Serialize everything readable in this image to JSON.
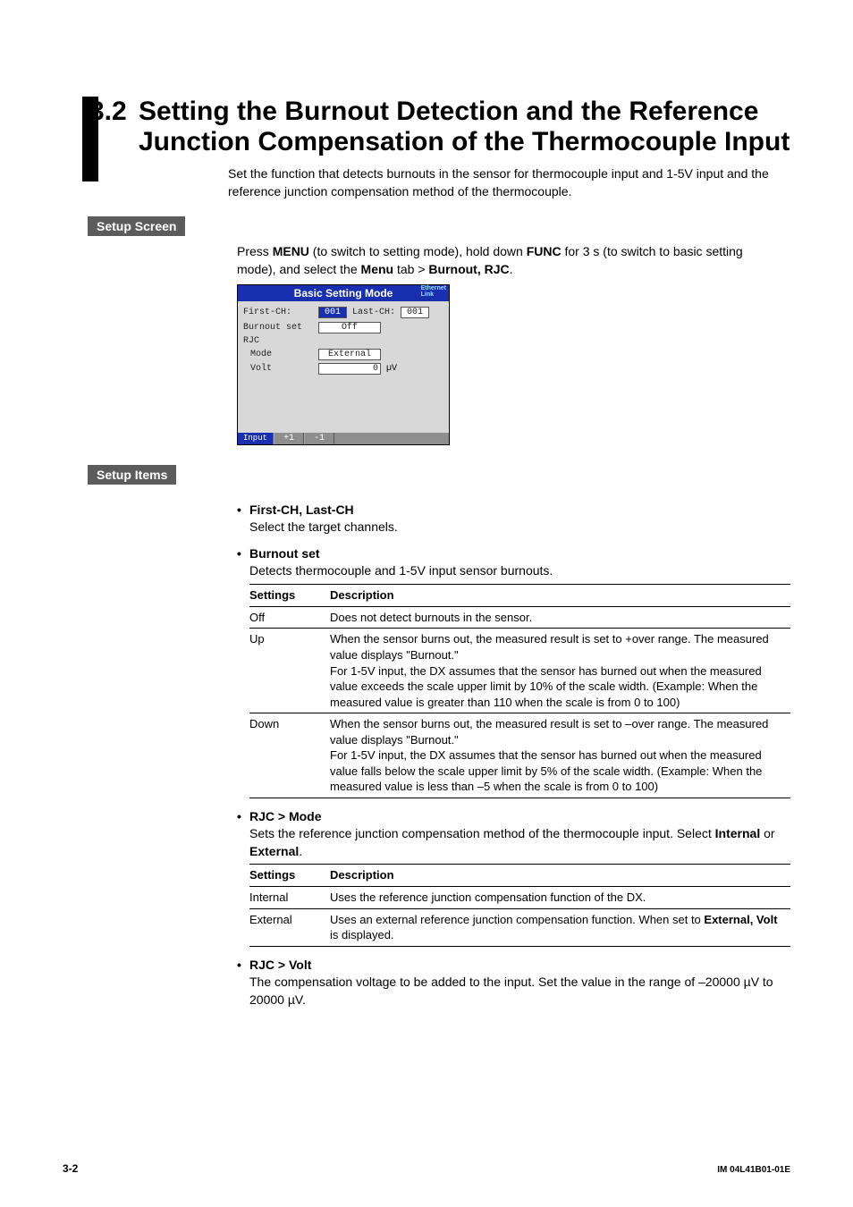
{
  "section_number": "3.2",
  "section_title": "Setting the Burnout Detection and the Reference Junction Compensation of the Thermocouple Input",
  "intro": "Set the function that detects burnouts in the sensor for thermocouple input and 1-5V input and the reference junction compensation method of the thermocouple.",
  "setup_screen": {
    "heading": "Setup Screen",
    "instruction_pre": "Press ",
    "menu_bold1": "MENU",
    "instruction_mid1": " (to switch to setting mode), hold down ",
    "func_bold": "FUNC",
    "instruction_mid2": " for 3 s (to switch to basic setting mode), and select the ",
    "menu_bold2": "Menu",
    "instruction_mid3": " tab > ",
    "path_bold": "Burnout, RJC",
    "instruction_end": ".",
    "ss": {
      "title": "Basic Setting Mode",
      "eth1": "Ethernet",
      "eth2": "Link",
      "first_ch_label": "First-CH:",
      "first_ch_val": "001",
      "last_ch_label": "Last-CH:",
      "last_ch_val": "001",
      "burnout_label": "Burnout set",
      "burnout_val": "Off",
      "rjc_label": "RJC",
      "mode_label": "Mode",
      "mode_val": "External",
      "volt_label": "Volt",
      "volt_val": "0",
      "volt_unit": "µV",
      "tab_input": "Input",
      "btn_plus": "+1",
      "btn_minus": "-1"
    }
  },
  "setup_items": {
    "heading": "Setup Items",
    "first_last": {
      "title": "First-CH, Last-CH",
      "desc": "Select the target channels."
    },
    "burnout": {
      "title": "Burnout set",
      "desc": "Detects thermocouple and 1-5V input sensor burnouts.",
      "col1": "Settings",
      "col2": "Description",
      "rows": [
        {
          "s": "Off",
          "d": "Does not detect burnouts in the sensor."
        },
        {
          "s": "Up",
          "d": "When the sensor burns out, the measured result is set to +over range. The measured value displays \"Burnout.\"\nFor 1-5V input, the DX assumes that the sensor has burned out when the measured value exceeds the scale upper limit by 10% of the scale width. (Example: When the measured value is greater than 110 when the scale is from 0 to 100)"
        },
        {
          "s": "Down",
          "d": "When the sensor burns out, the measured result is set to –over range. The measured value displays \"Burnout.\"\nFor 1-5V input, the DX assumes that the sensor has burned out when the measured value falls below the scale upper limit by 5% of the scale width. (Example: When the measured value is less than –5 when the scale is from 0 to 100)"
        }
      ]
    },
    "rjc_mode": {
      "title": "RJC > Mode",
      "desc_pre": "Sets the reference junction compensation method of the thermocouple input. Select ",
      "internal_b": "Internal",
      "or_txt": " or ",
      "external_b": "External",
      "desc_end": ".",
      "col1": "Settings",
      "col2": "Description",
      "rows": [
        {
          "s": "Internal",
          "d": "Uses the reference junction compensation function of the DX."
        },
        {
          "s": "External",
          "d_pre": "Uses an external reference junction compensation function. When set to ",
          "d_bold": "External, Volt",
          "d_post": " is displayed."
        }
      ]
    },
    "rjc_volt": {
      "title": "RJC > Volt",
      "desc": "The compensation voltage to be added to the input. Set the value in the range of –20000 µV to 20000 µV."
    }
  },
  "footer": {
    "page": "3-2",
    "doc": "IM 04L41B01-01E"
  }
}
